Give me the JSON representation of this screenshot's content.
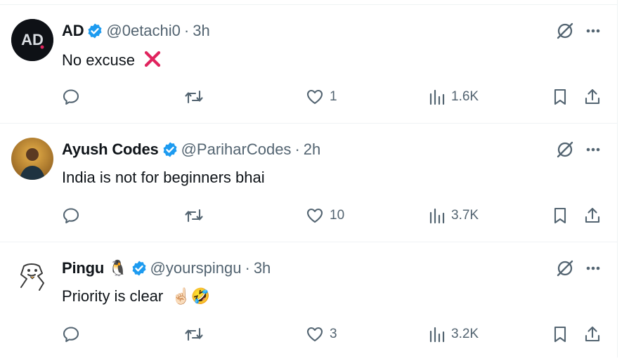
{
  "tweets": [
    {
      "name": "AD",
      "handle": "@0etachi0",
      "separator": "·",
      "time": "3h",
      "text": "No excuse",
      "text_emoji": "cross-mark",
      "avatar_label": "AD",
      "replies": "",
      "retweets": "",
      "likes": "1",
      "views": "1.6K"
    },
    {
      "name": "Ayush Codes",
      "handle": "@PariharCodes",
      "separator": "·",
      "time": "2h",
      "text": "India is not for beginners bhai",
      "avatar_label": "",
      "replies": "",
      "retweets": "",
      "likes": "10",
      "views": "3.7K"
    },
    {
      "name": "Pingu",
      "name_emoji": "🐧",
      "handle": "@yourspingu",
      "separator": "·",
      "time": "3h",
      "text": "Priority is clear",
      "text_emoji": "☝🏻🤣",
      "avatar_label": "",
      "replies": "",
      "retweets": "",
      "likes": "3",
      "views": "3.2K"
    }
  ],
  "colors": {
    "verified": "#1d9bf0",
    "muted": "#536471",
    "text": "#0f1419",
    "cross": "#e0245e",
    "divider": "#eff3f4"
  },
  "icons": [
    "verified-badge-icon",
    "grok-icon",
    "more-icon",
    "reply-icon",
    "retweet-icon",
    "like-icon",
    "views-icon",
    "bookmark-icon",
    "share-icon"
  ]
}
